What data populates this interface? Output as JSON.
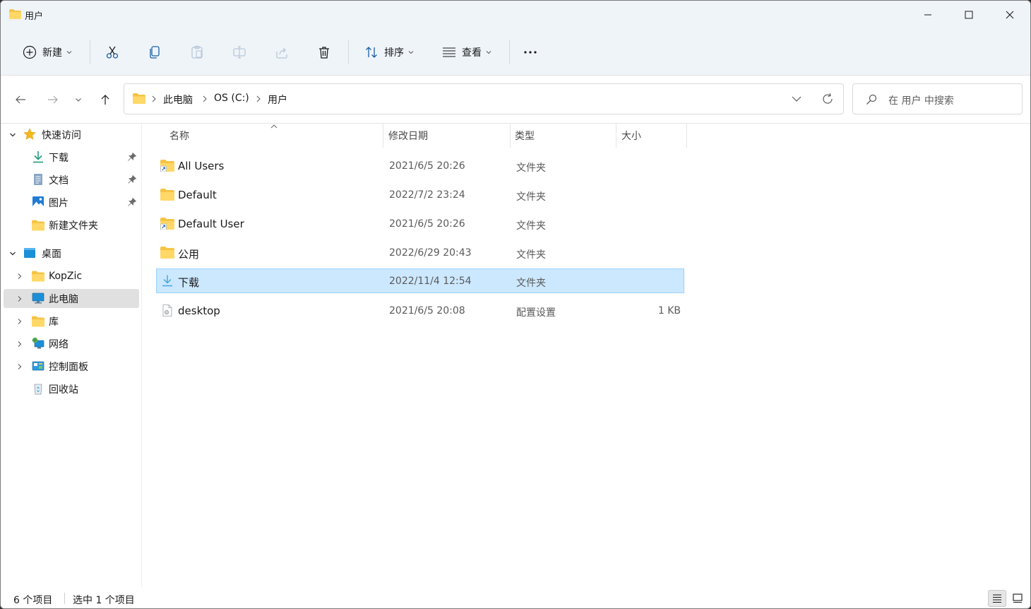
{
  "window": {
    "title": "用户"
  },
  "toolbar": {
    "new_label": "新建",
    "sort_label": "排序",
    "view_label": "查看",
    "more_label": "•••"
  },
  "address": {
    "crumbs": [
      "此电脑",
      "OS (C:)",
      "用户"
    ]
  },
  "search": {
    "placeholder": "在 用户 中搜索"
  },
  "sidebar": {
    "quick_access": "快速访问",
    "items": [
      {
        "label": "下载"
      },
      {
        "label": "文档"
      },
      {
        "label": "图片"
      },
      {
        "label": "新建文件夹"
      }
    ],
    "desktop": "桌面",
    "tree": [
      {
        "label": "KopZic"
      },
      {
        "label": "此电脑"
      },
      {
        "label": "库"
      },
      {
        "label": "网络"
      },
      {
        "label": "控制面板"
      },
      {
        "label": "回收站"
      }
    ]
  },
  "columns": {
    "name": "名称",
    "date": "修改日期",
    "type": "类型",
    "size": "大小"
  },
  "files": [
    {
      "name": "All Users",
      "date": "2021/6/5 20:26",
      "type": "文件夹",
      "size": "",
      "icon": "shortcut-folder-icon"
    },
    {
      "name": "Default",
      "date": "2022/7/2 23:24",
      "type": "文件夹",
      "size": "",
      "icon": "folder-icon"
    },
    {
      "name": "Default User",
      "date": "2021/6/5 20:26",
      "type": "文件夹",
      "size": "",
      "icon": "shortcut-folder-icon"
    },
    {
      "name": "公用",
      "date": "2022/6/29 20:43",
      "type": "文件夹",
      "size": "",
      "icon": "folder-icon"
    },
    {
      "name": "下载",
      "date": "2022/11/4 12:54",
      "type": "文件夹",
      "size": "",
      "icon": "download-icon",
      "selected": true
    },
    {
      "name": "desktop",
      "date": "2021/6/5 20:08",
      "type": "配置设置",
      "size": "1 KB",
      "icon": "settings-file-icon"
    }
  ],
  "status": {
    "count": "6 个项目",
    "selected": "选中 1 个项目"
  },
  "colors": {
    "accent": "#0067c0",
    "folder": "#f6c444",
    "selection": "#cce8ff",
    "chrome": "#eff4f9"
  }
}
